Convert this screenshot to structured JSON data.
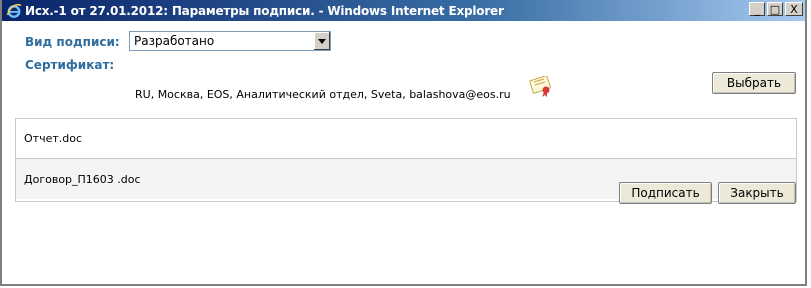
{
  "window": {
    "title": "Исх.-1 от 27.01.2012: Параметры подписи. - Windows Internet Explorer",
    "minimize_label": "_",
    "maximize_label": "□",
    "close_label": "X"
  },
  "form": {
    "signature_type_label": "Вид подписи:",
    "signature_type_value": "Разработано",
    "certificate_label": "Сертификат:",
    "certificate_value": "RU, Москва, EOS, Аналитический отдел, Sveta, balashova@eos.ru",
    "choose_button": "Выбрать"
  },
  "files": [
    {
      "name": "Отчет.doc"
    },
    {
      "name": "Договор_П1603 .doc"
    }
  ],
  "actions": {
    "sign_button": "Подписать",
    "close_button": "Закрыть"
  },
  "icons": {
    "browser": "internet-explorer-icon",
    "certificate": "certificate-icon",
    "dropdown": "chevron-down-icon"
  },
  "colors": {
    "label": "#2e6d9e",
    "titlebar": "#0a246a"
  }
}
